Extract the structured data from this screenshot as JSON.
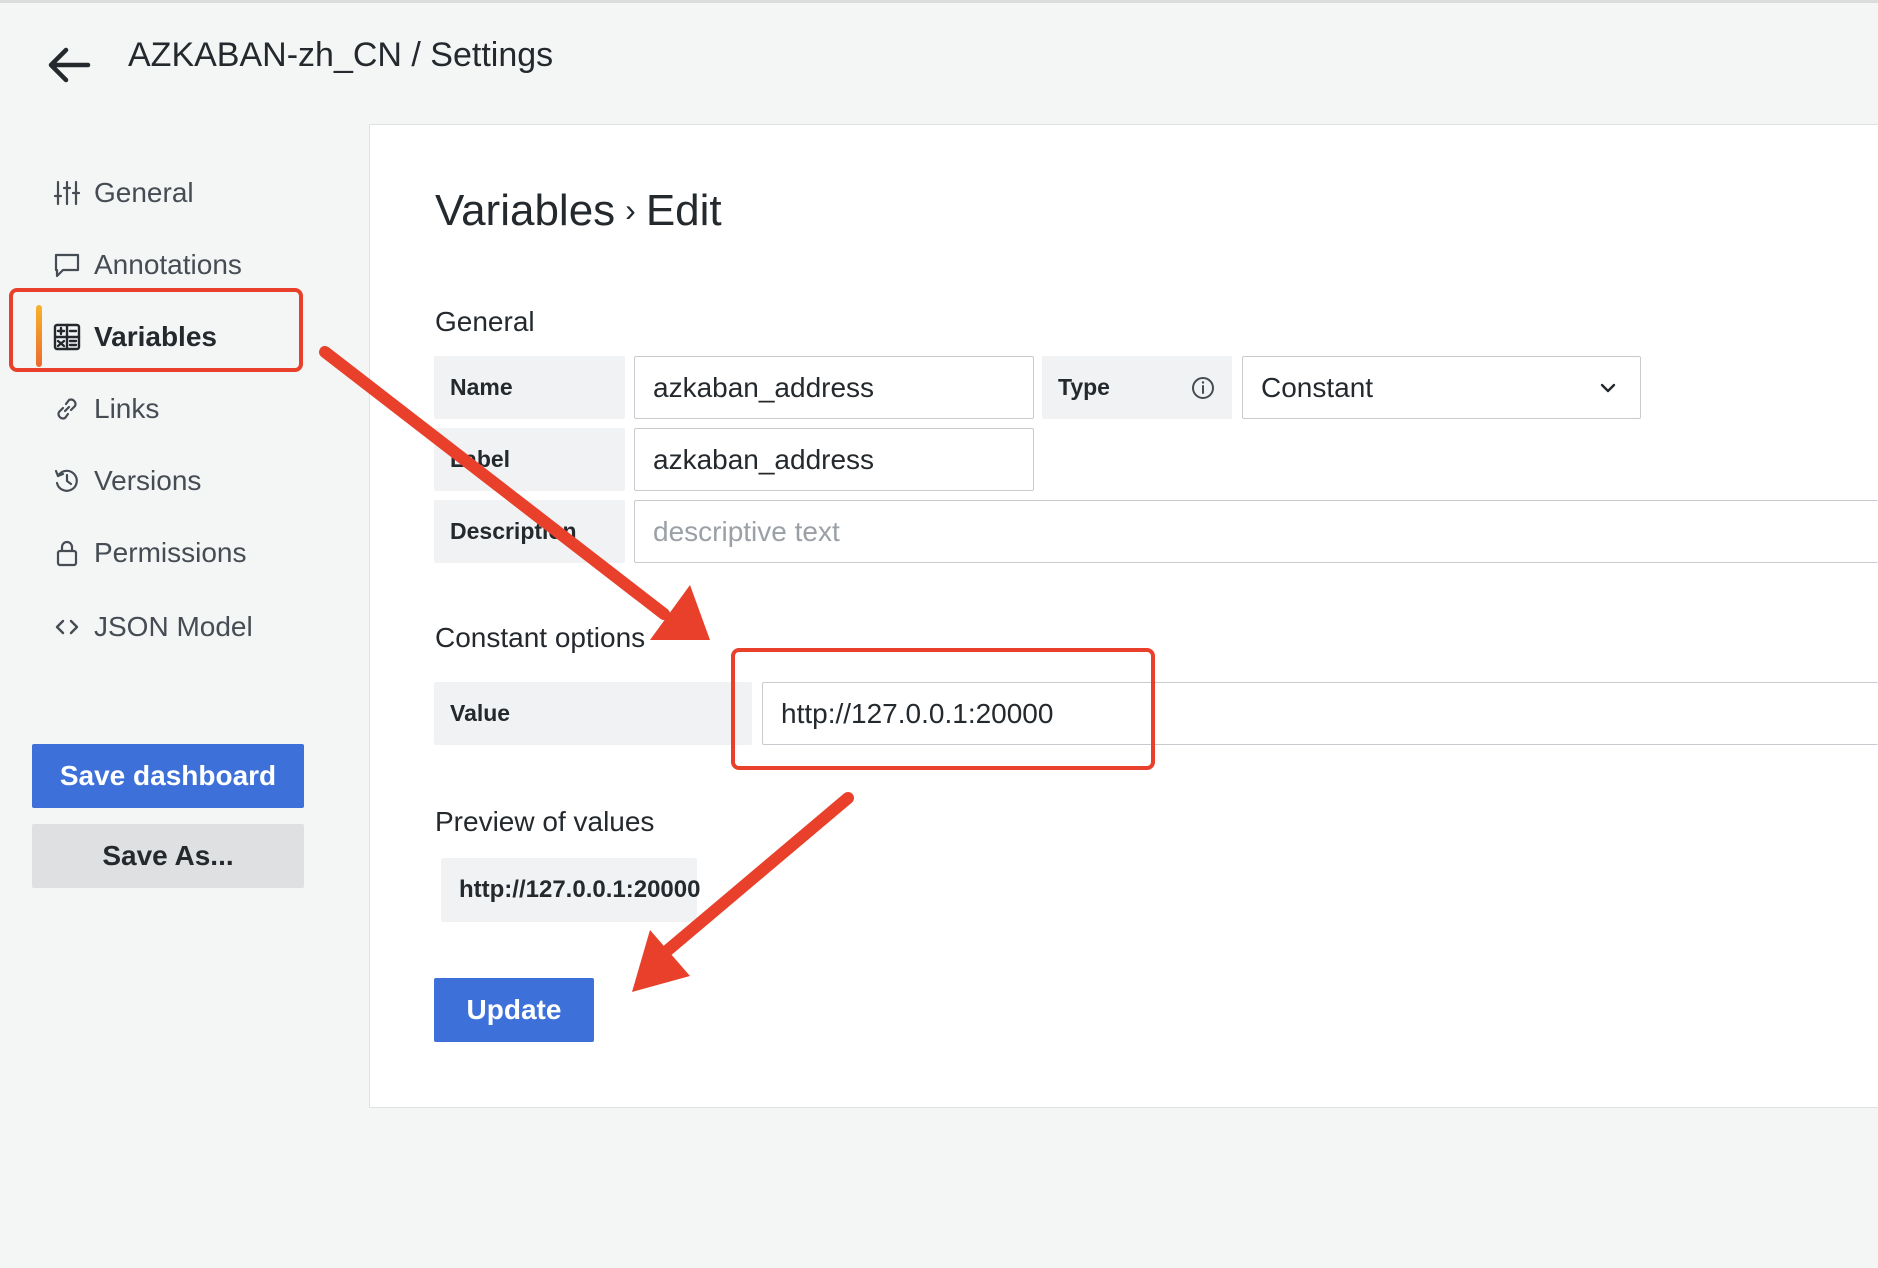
{
  "header": {
    "title": "AZKABAN-zh_CN / Settings",
    "back_icon": "arrow-left-icon"
  },
  "sidebar": {
    "items": [
      {
        "label": "General",
        "icon": "sliders-icon"
      },
      {
        "label": "Annotations",
        "icon": "comment-icon"
      },
      {
        "label": "Variables",
        "icon": "calculator-icon",
        "active": true
      },
      {
        "label": "Links",
        "icon": "link-icon"
      },
      {
        "label": "Versions",
        "icon": "history-icon"
      },
      {
        "label": "Permissions",
        "icon": "lock-icon"
      },
      {
        "label": "JSON Model",
        "icon": "code-icon"
      }
    ],
    "save_dashboard_label": "Save dashboard",
    "save_as_label": "Save As..."
  },
  "main": {
    "heading_section": "Variables",
    "heading_separator": "›",
    "heading_page": "Edit",
    "general_title": "General",
    "name_label": "Name",
    "name_value": "azkaban_address",
    "type_label": "Type",
    "type_value": "Constant",
    "label_label": "Label",
    "label_value": "azkaban_address",
    "description_label": "Description",
    "description_placeholder": "descriptive text",
    "constant_options_title": "Constant options",
    "value_label": "Value",
    "value_value": "http://127.0.0.1:20000",
    "preview_title": "Preview of values",
    "preview_value": "http://127.0.0.1:20000",
    "update_label": "Update"
  },
  "colors": {
    "primary": "#3d71d9",
    "annotation": "#e8402b",
    "active_bar_top": "#f7b32a",
    "active_bar_bottom": "#ea6b2c"
  }
}
